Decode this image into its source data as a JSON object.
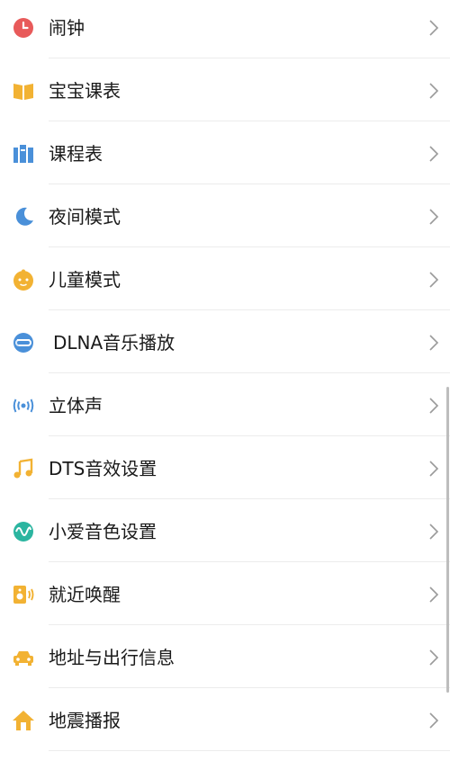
{
  "settings_list": {
    "items": [
      {
        "label": "闹钟",
        "icon": "alarm-clock-icon",
        "color": "#e85a5a"
      },
      {
        "label": "宝宝课表",
        "icon": "open-book-icon",
        "color": "#f2b233"
      },
      {
        "label": "课程表",
        "icon": "books-shelf-icon",
        "color": "#4a90d9"
      },
      {
        "label": "夜间模式",
        "icon": "moon-icon",
        "color": "#4a90d9"
      },
      {
        "label": "儿童模式",
        "icon": "child-face-icon",
        "color": "#f2b233"
      },
      {
        "label": "DLNA音乐播放",
        "icon": "dlna-icon",
        "color": "#4a90d9"
      },
      {
        "label": "立体声",
        "icon": "stereo-broadcast-icon",
        "color": "#4a90d9"
      },
      {
        "label": "DTS音效设置",
        "icon": "music-note-icon",
        "color": "#f2b233"
      },
      {
        "label": "小爱音色设置",
        "icon": "sound-wave-icon",
        "color": "#2bb5a0"
      },
      {
        "label": "就近唤醒",
        "icon": "speaker-icon",
        "color": "#f2b233"
      },
      {
        "label": "地址与出行信息",
        "icon": "car-icon",
        "color": "#f2b233"
      },
      {
        "label": "地震播报",
        "icon": "house-icon",
        "color": "#f2b233"
      },
      {
        "label": "",
        "icon": "partial-icon",
        "color": "#2bb5a0"
      }
    ]
  }
}
